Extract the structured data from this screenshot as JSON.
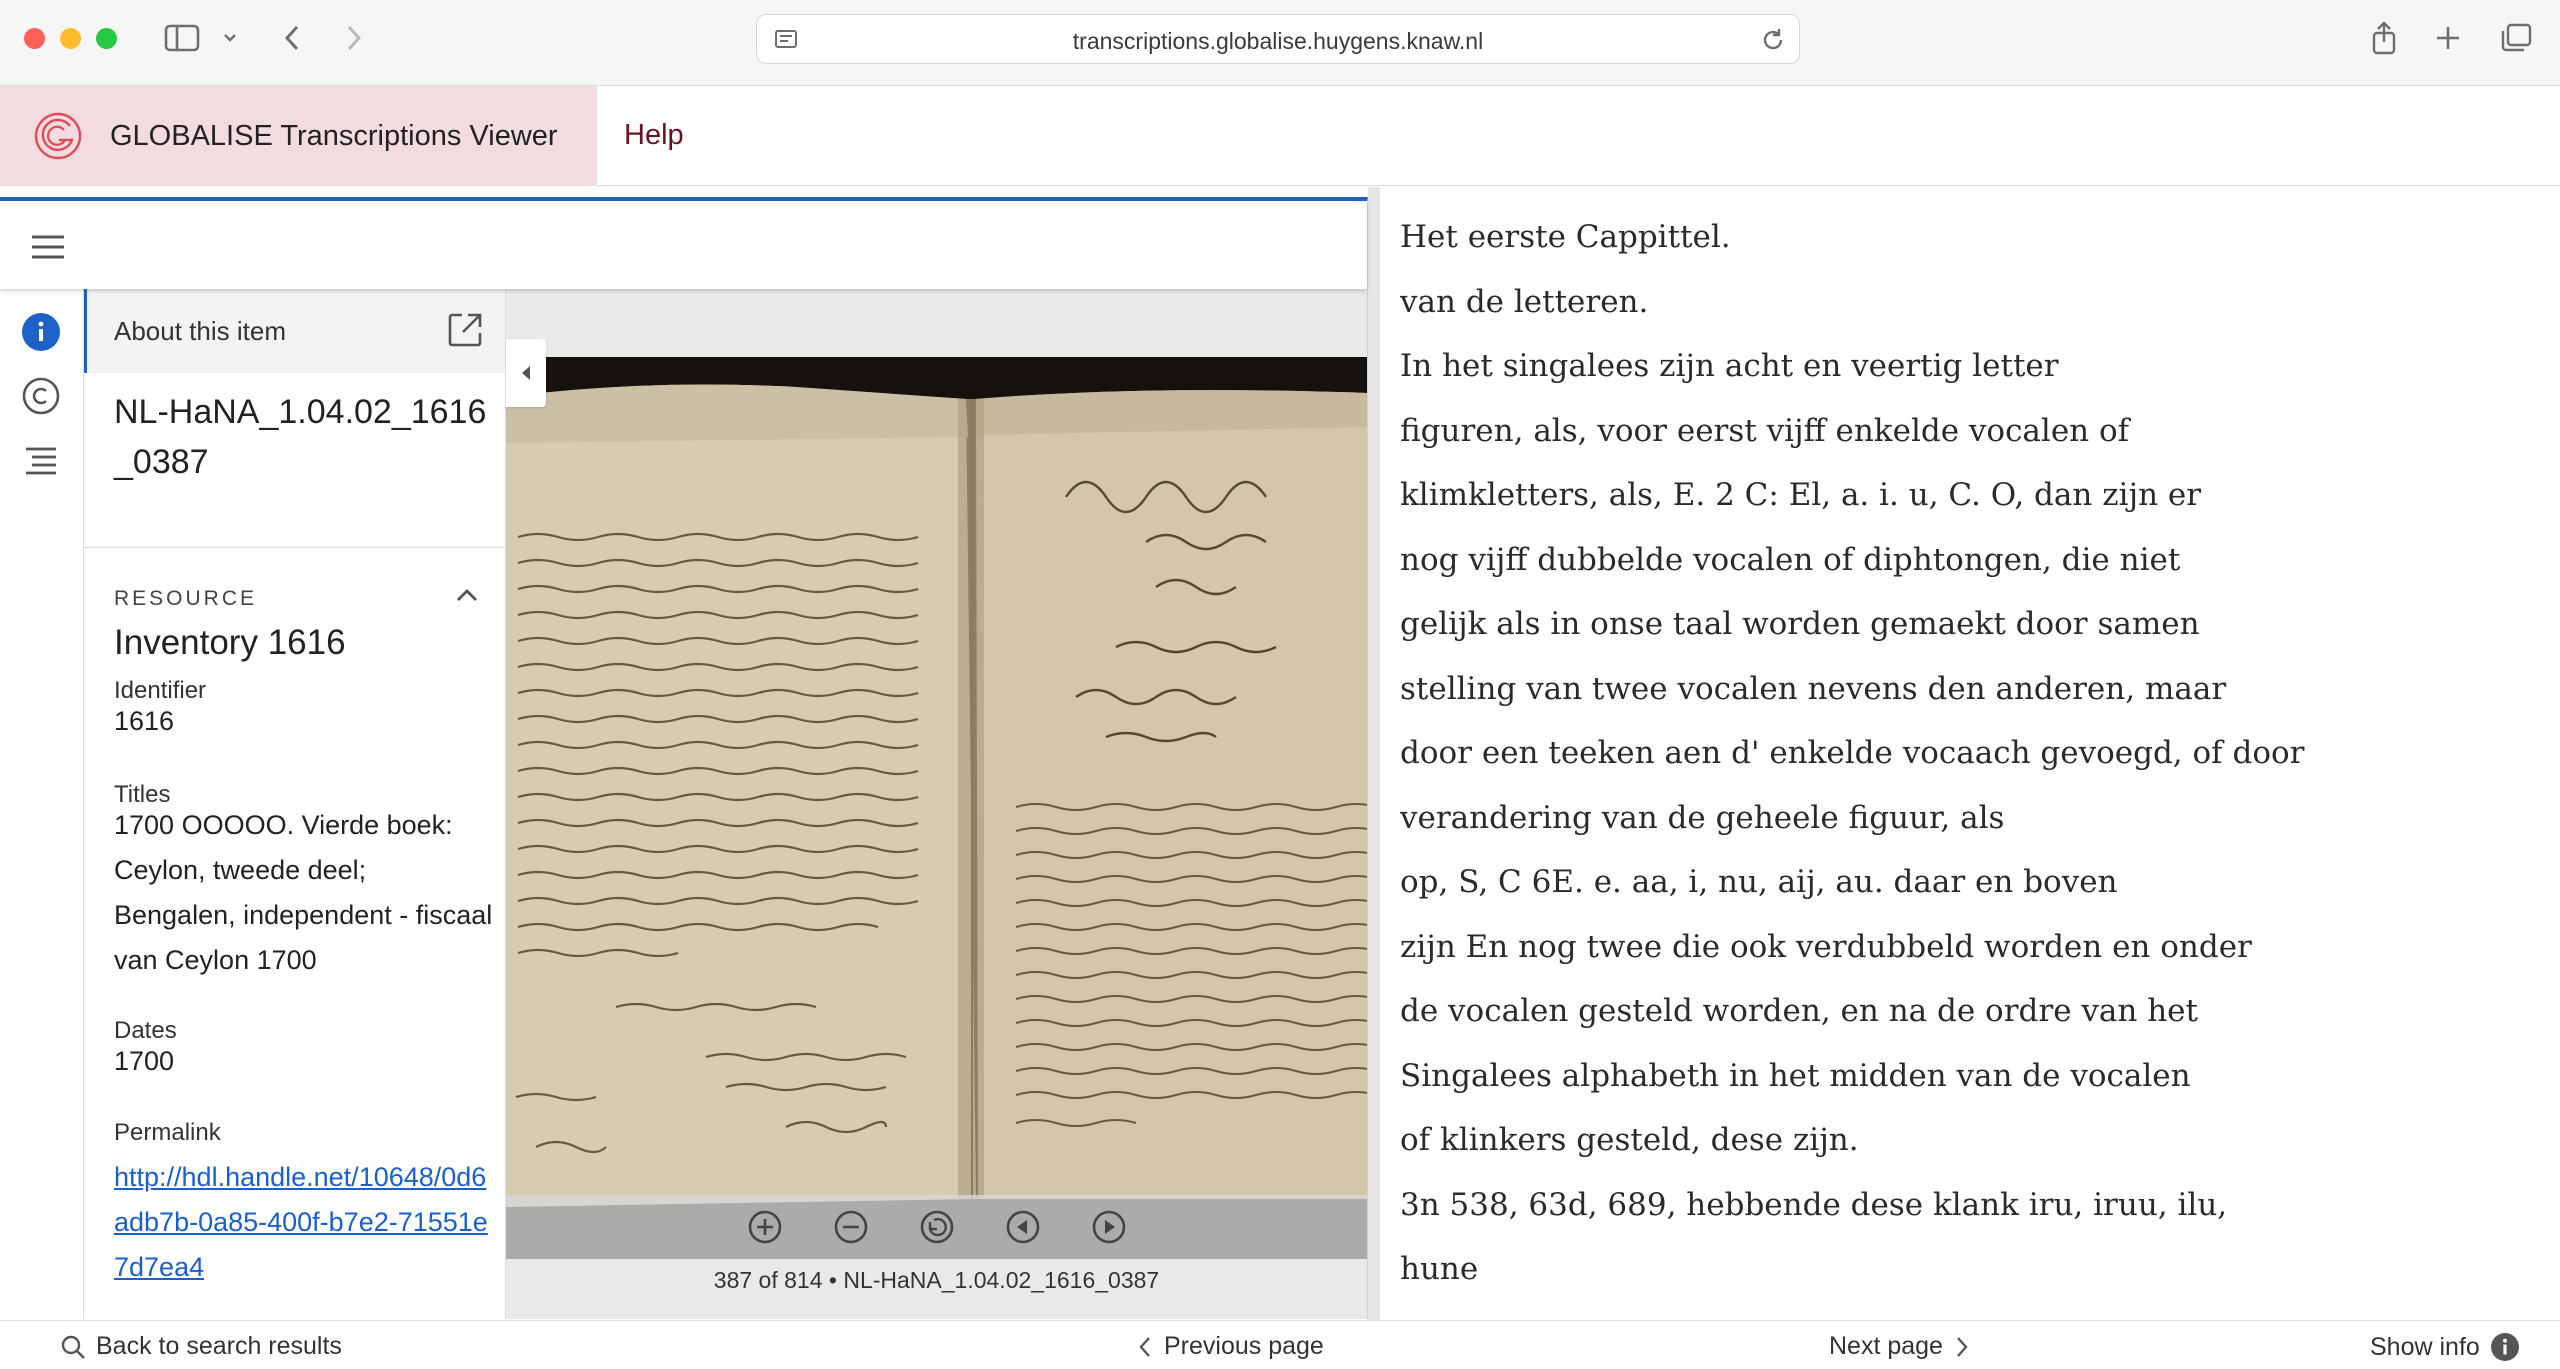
{
  "browser": {
    "url": "transcriptions.globalise.huygens.knaw.nl"
  },
  "header": {
    "app_title": "GLOBALISE Transcriptions Viewer",
    "help_label": "Help",
    "brand_color": "#e04a5a"
  },
  "info_panel": {
    "about_label": "About this item",
    "item_title": "NL-HaNA_1.04.02_1616_0387",
    "resource_heading": "RESOURCE",
    "resource_name": "Inventory 1616",
    "identifier_label": "Identifier",
    "identifier_value": "1616",
    "titles_label": "Titles",
    "titles_value": "1700 OOOOO. Vierde boek: Ceylon, tweede deel; Bengalen, independent - fiscaal van Ceylon 1700",
    "dates_label": "Dates",
    "dates_value": "1700",
    "permalink_label": "Permalink",
    "permalink_value": "http://hdl.handle.net/10648/0d6adb7b-0a85-400f-b7e2-71551e7d7ea4"
  },
  "viewer": {
    "page_caption": "387 of 814 • NL-HaNA_1.04.02_1616_0387",
    "accent_color": "#1e62c9"
  },
  "transcription": {
    "lines": [
      "Het eerste Cappittel.",
      "van de letteren.",
      "In het singalees zijn acht en veertig letter",
      "figuren, als, voor eerst vijff enkelde vocalen of",
      "klimkletters, als, E. 2 C: El, a. i. u, C. O, dan zijn er",
      "nog vijff dubbelde vocalen of diphtongen, die niet",
      "gelijk als in onse taal worden gemaekt door samen",
      "stelling van twee vocalen nevens den anderen, maar",
      "door een teeken aen d' enkelde vocaach gevoegd, of door",
      "verandering van de geheele figuur, als",
      "op, S, C 6E. e. aa, i, nu, aij, au. daar en boven",
      "zijn En nog twee die ook verdubbeld worden en onder",
      "de vocalen gesteld worden, en na de ordre van het",
      "Singalees alphabeth in het midden van de vocalen",
      "of klinkers gesteld, dese zijn.",
      "3n 538, 63d, 689, hebbende dese klank iru, iruu, ilu,",
      "hune"
    ]
  },
  "footer": {
    "back_label": "Back to search results",
    "prev_label": "Previous page",
    "next_label": "Next page",
    "info_label": "Show info"
  }
}
